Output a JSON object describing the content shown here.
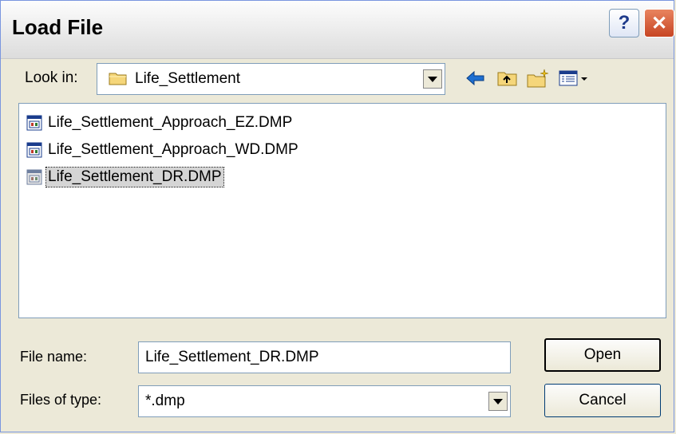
{
  "window": {
    "title": "Load File"
  },
  "toolbar": {
    "look_in_label": "Look in:",
    "look_in_value": "Life_Settlement"
  },
  "files": [
    {
      "name": "Life_Settlement_Approach_EZ.DMP",
      "selected": false
    },
    {
      "name": "Life_Settlement_Approach_WD.DMP",
      "selected": false
    },
    {
      "name": "Life_Settlement_DR.DMP",
      "selected": true
    }
  ],
  "form": {
    "file_name_label": "File name:",
    "file_name_value": "Life_Settlement_DR.DMP",
    "file_type_label": "Files of type:",
    "file_type_value": "*.dmp"
  },
  "buttons": {
    "open": "Open",
    "cancel": "Cancel"
  },
  "colors": {
    "dialog_bg": "#ece9d8",
    "selection": "#d5d5d5",
    "close": "#c74523"
  },
  "icons": [
    "help-icon",
    "close-icon",
    "folder-icon",
    "back-arrow-icon",
    "up-folder-icon",
    "new-folder-icon",
    "view-menu-icon",
    "dmp-file-icon"
  ]
}
